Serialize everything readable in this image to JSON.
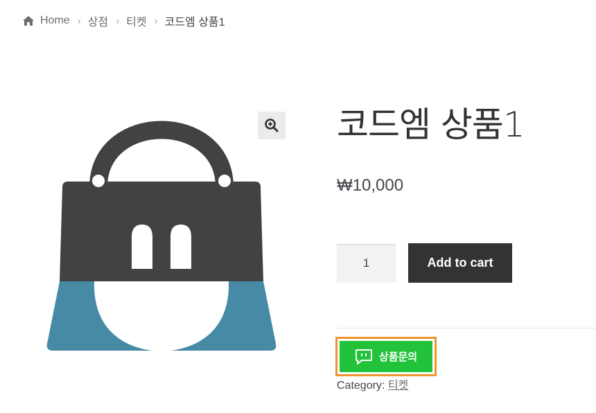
{
  "breadcrumb": {
    "items": [
      {
        "label": "Home",
        "icon": "home-icon"
      },
      {
        "label": "상점"
      },
      {
        "label": "티켓"
      }
    ],
    "current": "코드엠 상품1"
  },
  "product": {
    "title": "코드엠 상품1",
    "price": "₩10,000",
    "image_icon": "shopping-bag-icon",
    "zoom_icon": "zoom-in-icon"
  },
  "cart": {
    "quantity": "1",
    "add_to_cart_label": "Add to cart"
  },
  "inquiry": {
    "label": "상품문의",
    "icon": "chat-icon",
    "button_color": "#22c33a",
    "highlight_color": "#f0952b"
  },
  "meta": {
    "category_label": "Category:",
    "category_value": "티켓"
  },
  "colors": {
    "bag_dark": "#424242",
    "bag_blue": "#468aa6",
    "button_dark": "#333333"
  }
}
